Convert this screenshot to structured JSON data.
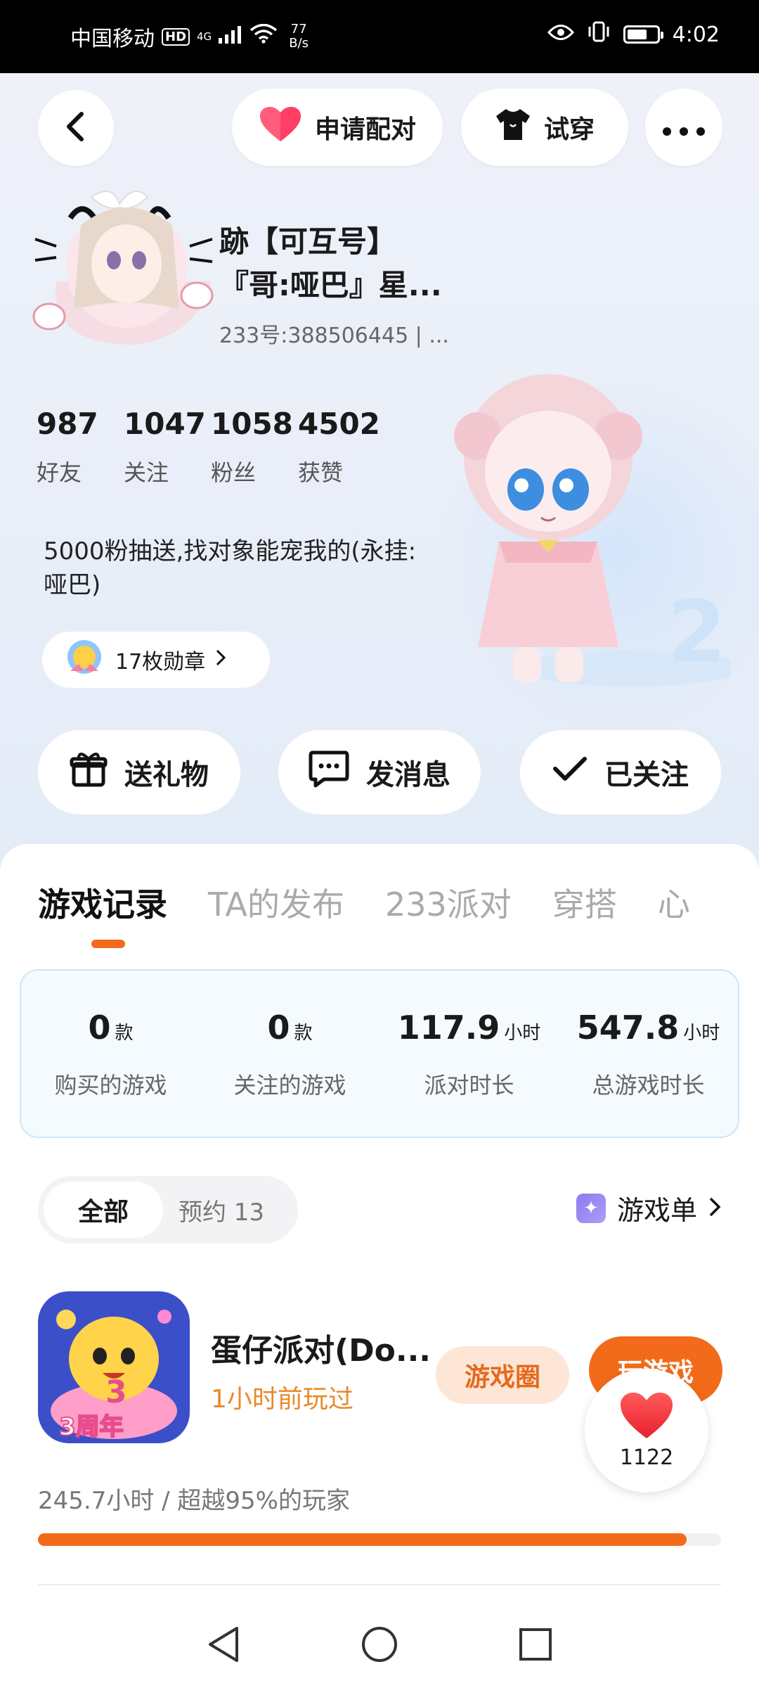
{
  "status_bar": {
    "carrier": "中国移动",
    "hd": "HD",
    "network": "4G",
    "speed_value": "77",
    "speed_unit": "B/s",
    "time": "4:02",
    "battery_level": 0.6
  },
  "header": {
    "match_label": "申请配对",
    "try_label": "试穿"
  },
  "profile": {
    "name_line1": "跡【可互号】",
    "name_line2": "『哥:哑巴』星...",
    "uid": "233号:388506445 | ...",
    "stats": [
      {
        "value": "987",
        "label": "好友"
      },
      {
        "value": "1047",
        "label": "关注"
      },
      {
        "value": "1058",
        "label": "粉丝"
      },
      {
        "value": "4502",
        "label": "获赞"
      }
    ],
    "bio": "5000粉抽送,找对象能宠我的(永挂:哑巴)",
    "medal_label": "17枚勋章"
  },
  "actions": {
    "gift": "送礼物",
    "message": "发消息",
    "follow": "已关注"
  },
  "tabs": [
    "游戏记录",
    "TA的发布",
    "233派对",
    "穿搭",
    "心"
  ],
  "summary": [
    {
      "value": "0",
      "unit": "款",
      "label": "购买的游戏"
    },
    {
      "value": "0",
      "unit": "款",
      "label": "关注的游戏"
    },
    {
      "value": "117.9",
      "unit": "小时",
      "label": "派对时长"
    },
    {
      "value": "547.8",
      "unit": "小时",
      "label": "总游戏时长"
    }
  ],
  "filter": {
    "all": "全部",
    "reserved": "预约 13",
    "game_list": "游戏单"
  },
  "game": {
    "title": "蛋仔派对(Do...",
    "played": "1小时前玩过",
    "circle_btn": "游戏圈",
    "play_btn": "玩游戏",
    "hours": "245.7小时 / 超越95%的玩家",
    "progress": 0.95,
    "badge": "3周年"
  },
  "like_count": "1122",
  "colors": {
    "accent": "#f26b1a",
    "accent_light": "#fde6d6",
    "summary_bg": "#f4fafe"
  }
}
